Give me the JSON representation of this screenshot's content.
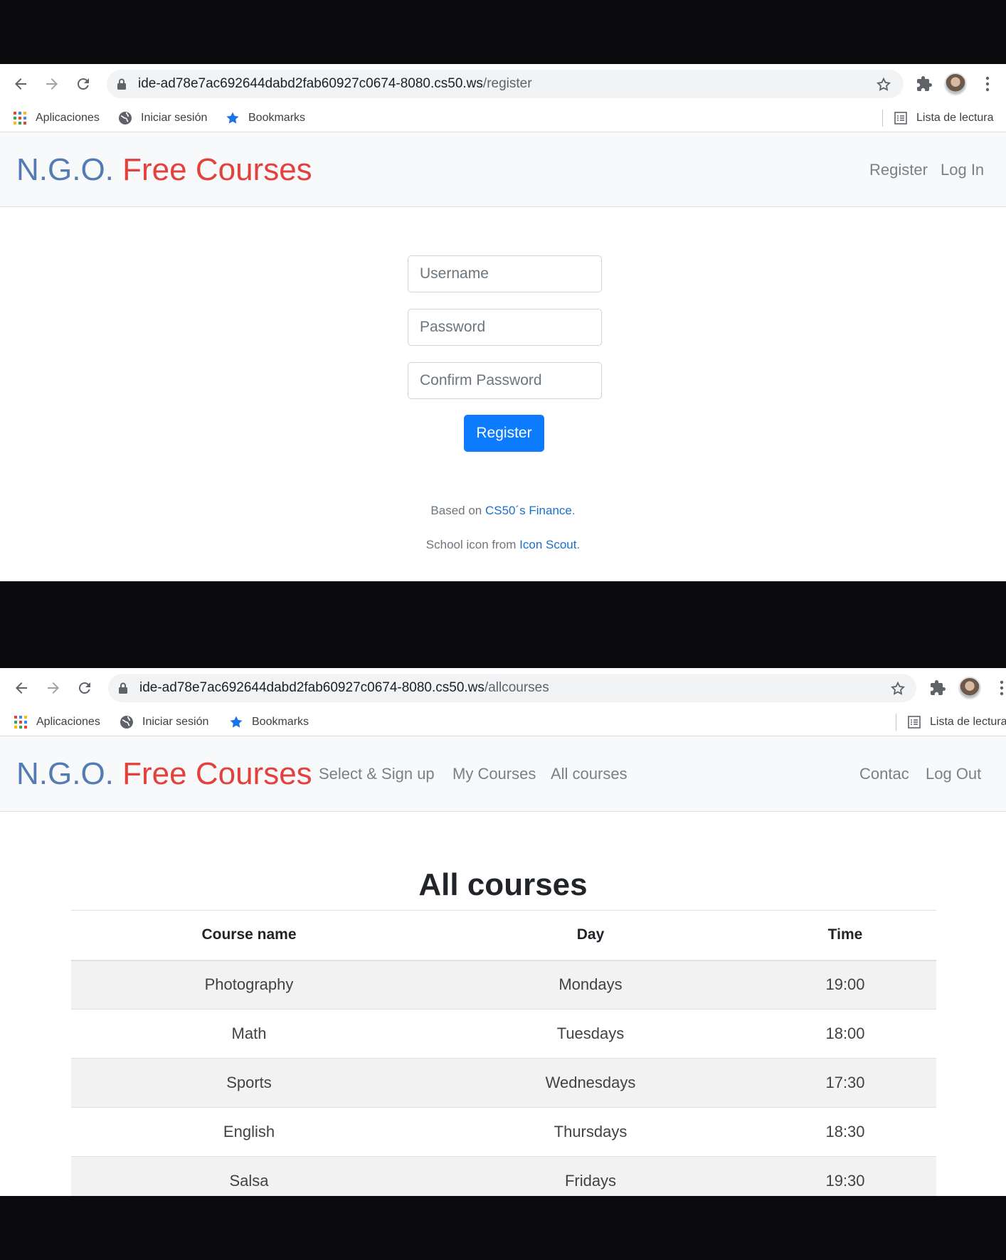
{
  "browser1": {
    "url_host": "ide-ad78e7ac692644dabd2fab60927c0674-8080.cs50.ws",
    "url_path": "/register",
    "bookmarks": [
      "Aplicaciones",
      "Iniciar sesión",
      "Bookmarks"
    ],
    "reading_list": "Lista de lectura"
  },
  "browser2": {
    "url_host": "ide-ad78e7ac692644dabd2fab60927c0674-8080.cs50.ws",
    "url_path": "/allcourses",
    "bookmarks": [
      "Aplicaciones",
      "Iniciar sesión",
      "Bookmarks"
    ],
    "reading_list": "Lista de lectura"
  },
  "brand": {
    "part1": "N.G.O.",
    "part2": "Free Courses"
  },
  "register_page": {
    "nav": {
      "register": "Register",
      "login": "Log In"
    },
    "form": {
      "username_placeholder": "Username",
      "password_placeholder": "Password",
      "confirm_placeholder": "Confirm Password",
      "submit_label": "Register"
    },
    "footer": {
      "line1_prefix": "Based on ",
      "line1_link": "CS50´s Finance",
      "line1_suffix": ".",
      "line2_prefix": "School icon from ",
      "line2_link": "Icon Scout",
      "line2_suffix": "."
    }
  },
  "courses_page": {
    "nav": {
      "select_signup": "Select & Sign up",
      "my_courses": "My Courses",
      "all_courses": "All courses",
      "contact": "Contac",
      "logout": "Log Out"
    },
    "heading": "All courses",
    "table": {
      "headers": [
        "Course name",
        "Day",
        "Time"
      ],
      "rows": [
        [
          "Photography",
          "Mondays",
          "19:00"
        ],
        [
          "Math",
          "Tuesdays",
          "18:00"
        ],
        [
          "Sports",
          "Wednesdays",
          "17:30"
        ],
        [
          "English",
          "Thursdays",
          "18:30"
        ],
        [
          "Salsa",
          "Fridays",
          "19:30"
        ]
      ]
    }
  },
  "colors": {
    "brand_blue": "#537bb4",
    "brand_red": "#e2413c",
    "primary_button": "#0d7bff",
    "link": "#1b6fcc"
  }
}
